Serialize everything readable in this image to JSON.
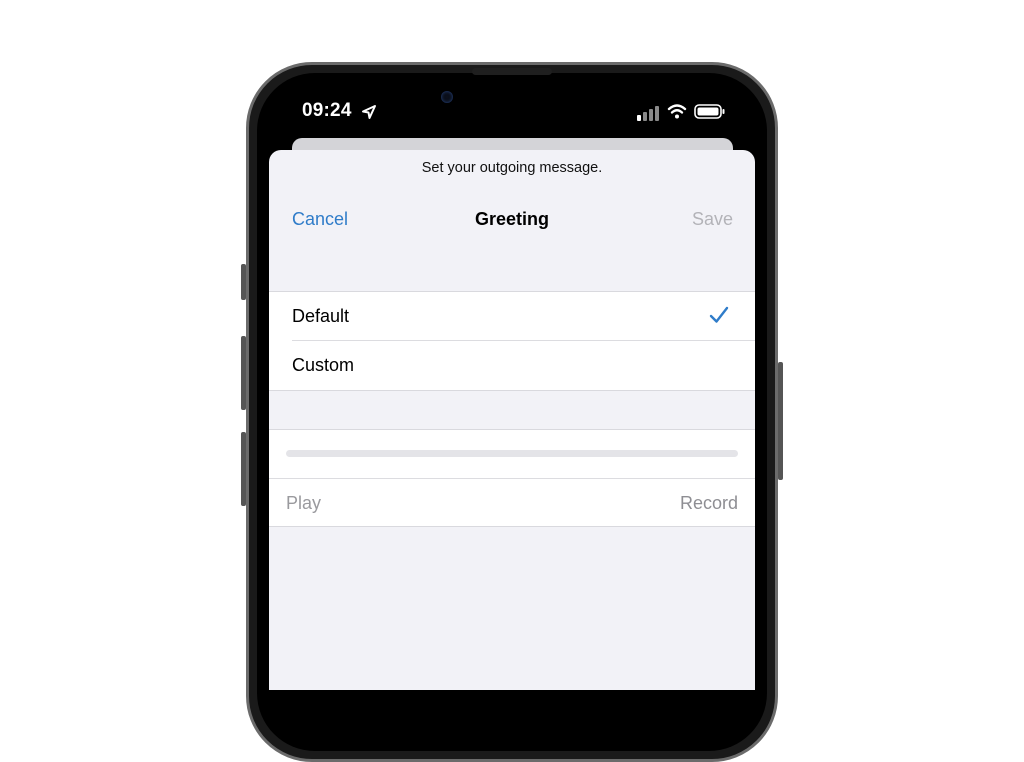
{
  "status_bar": {
    "time": "09:24",
    "icons": [
      "location-arrow-icon",
      "cellular-signal-icon",
      "wifi-icon",
      "battery-icon"
    ]
  },
  "sheet": {
    "prompt": "Set your outgoing message.",
    "nav": {
      "cancel_label": "Cancel",
      "title": "Greeting",
      "save_label": "Save"
    },
    "options": [
      {
        "label": "Default",
        "selected": true
      },
      {
        "label": "Custom",
        "selected": false
      }
    ],
    "player": {
      "progress": 0,
      "play_label": "Play",
      "record_label": "Record"
    }
  },
  "colors": {
    "accent": "#2f7cc9",
    "disabled": "#b3b3b8",
    "sheet_background": "#f2f2f7"
  }
}
